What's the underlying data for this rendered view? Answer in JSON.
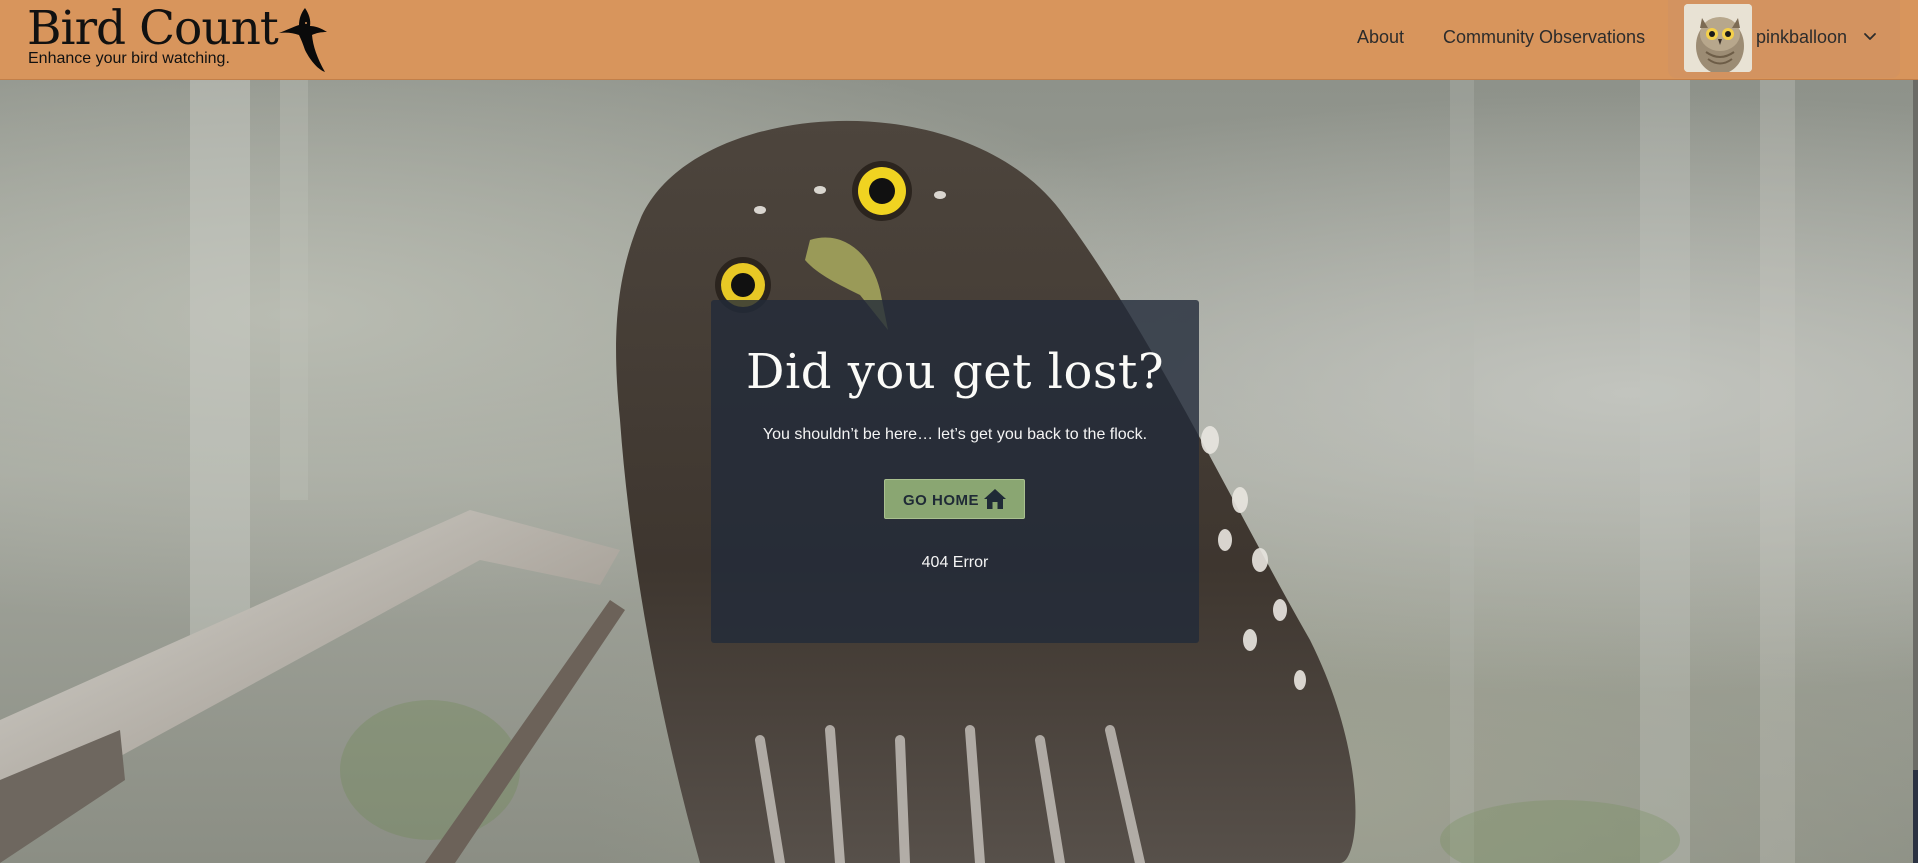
{
  "header": {
    "brand_title": "Bird Count",
    "brand_tagline": "Enhance your bird watching.",
    "brand_icon": "bird-silhouette-icon",
    "background_color": "#d8955c",
    "nav": {
      "about": "About",
      "community": "Community Observations"
    },
    "user": {
      "username": "pinkballoon",
      "avatar_icon": "owl-avatar-icon",
      "menu_icon": "chevron-down-icon"
    }
  },
  "error_card": {
    "title": "Did you get lost?",
    "message": "You shouldn’t be here… let’s get you back to the flock.",
    "button_label": "GO HOME",
    "button_icon": "home-icon",
    "button_color": "#8aa672",
    "footer": "404 Error"
  },
  "hero": {
    "image": "owl-photo-background"
  }
}
